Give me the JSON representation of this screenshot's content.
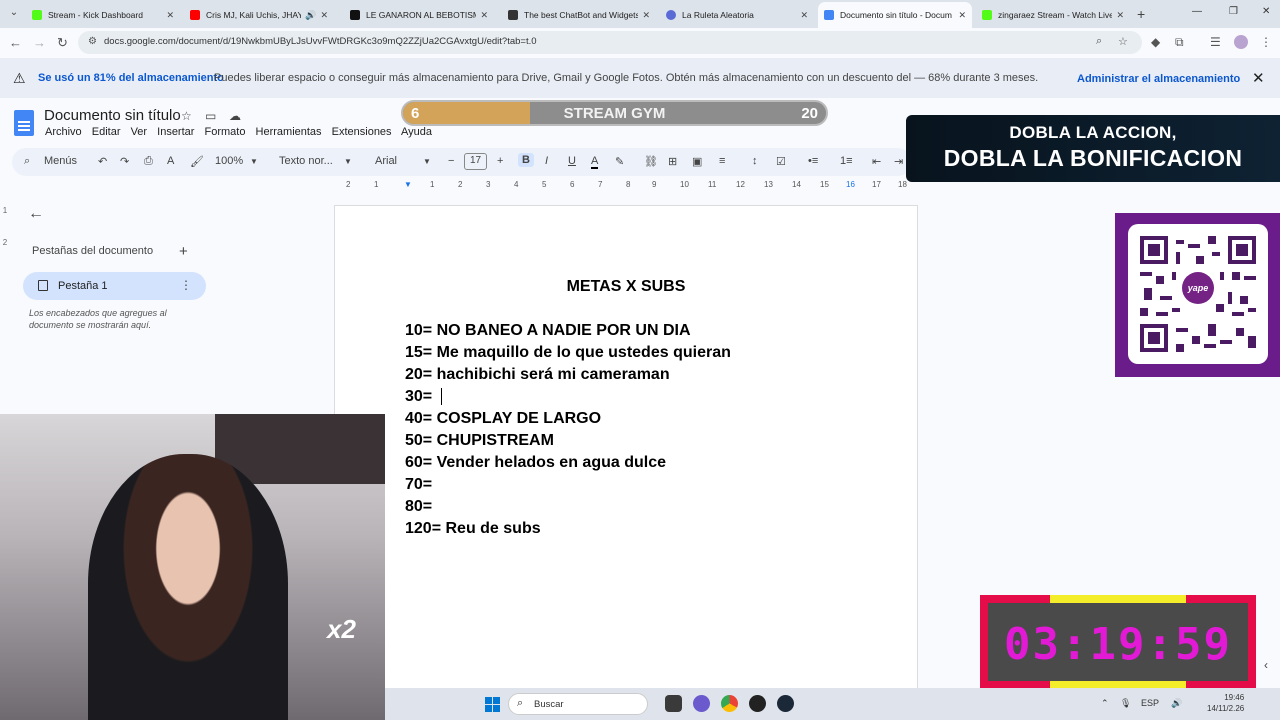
{
  "browser": {
    "tabs": [
      {
        "title": "Stream - Kick Dashboard",
        "color": "#53fc18"
      },
      {
        "title": "Cris MJ, Kali Uchis, JHAYCO",
        "color": "#ff0000"
      },
      {
        "title": "LE GANARON AL BEBOTISMO",
        "color": "#111111"
      },
      {
        "title": "The best ChatBot and Widgets",
        "color": "#333333"
      },
      {
        "title": "La Ruleta Aleatoria",
        "color": "#5b6bd6"
      },
      {
        "title": "Documento sin título - Docum",
        "color": "#4285f4"
      },
      {
        "title": "zingaraez Stream - Watch Live",
        "color": "#53fc18"
      }
    ],
    "new_tab": "+",
    "url": "docs.google.com/document/d/19NwkbmUByLJsUvvFWtDRGKc3o9mQ2ZZjUa2CGAvxtgU/edit?tab=t.0"
  },
  "banner": {
    "usage": "Se usó un 81% del almacenamiento",
    "message": "Puedes liberar espacio o conseguir más almacenamiento para Drive, Gmail y Google Fotos. Obtén más almacenamiento con un descuento del — 68% durante 3 meses.",
    "action": "Administrar el almacenamiento"
  },
  "docs": {
    "title": "Documento sin título",
    "menus": [
      "Archivo",
      "Editar",
      "Ver",
      "Insertar",
      "Formato",
      "Herramientas",
      "Extensiones",
      "Ayuda"
    ],
    "toolbar": {
      "menus_label": "Menús",
      "zoom": "100%",
      "style": "Texto nor...",
      "font": "Arial",
      "font_size": "17"
    },
    "ruler": [
      "2",
      "1",
      "1",
      "2",
      "3",
      "4",
      "5",
      "6",
      "7",
      "8",
      "9",
      "10",
      "11",
      "12",
      "13",
      "14",
      "15",
      "16",
      "17",
      "18"
    ],
    "outline": {
      "heading": "Pestañas del documento",
      "tab_label": "Pestaña 1",
      "note": "Los encabezados que agregues al documento se mostrarán aquí."
    },
    "page": {
      "title": "METAS X SUBS",
      "goals": [
        "10= NO BANEO A NADIE POR UN DIA",
        "15= Me maquillo de lo que ustedes quieran",
        "20= hachibichi será mi cameraman",
        "30= ",
        "40= COSPLAY DE LARGO",
        "50= CHUPISTREAM",
        "60= Vender helados en agua dulce",
        "70=",
        "80=",
        "120= Reu de subs"
      ]
    }
  },
  "overlays": {
    "stream_gym": {
      "current": "6",
      "label": "STREAM GYM",
      "goal": "20",
      "progress": 0.3
    },
    "promo": {
      "line1": "DOBLA LA ACCION,",
      "line2": "DOBLA LA BONIFICACION"
    },
    "qr_brand": "yape",
    "timer": "03:19:59",
    "webcam_badge": "x2"
  },
  "taskbar": {
    "search": "Buscar",
    "time": "19:46",
    "date": "14/11/2.26",
    "lang": "ESP"
  }
}
